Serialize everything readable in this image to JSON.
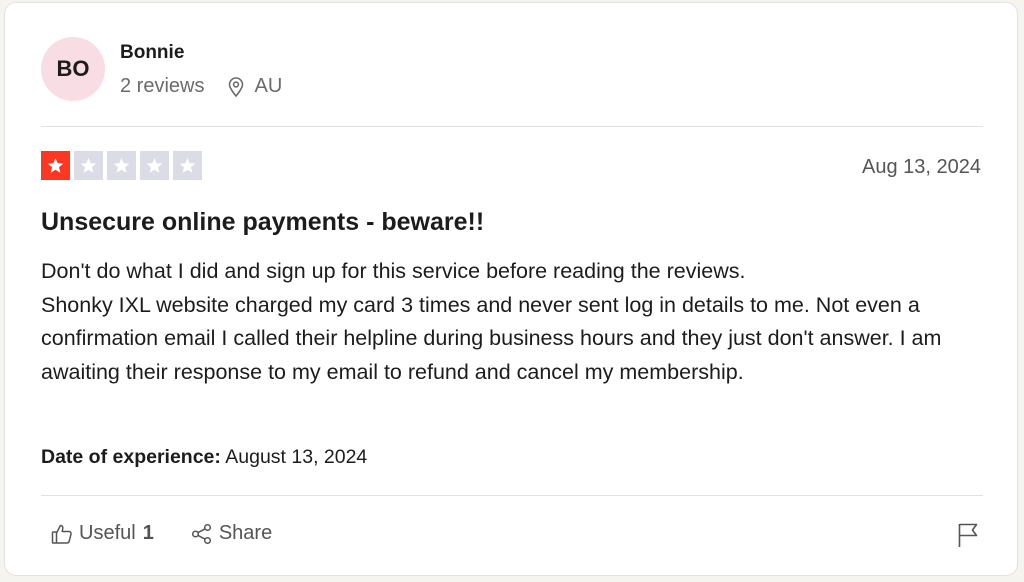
{
  "reviewer": {
    "initials": "BO",
    "avatar_color": "#f9dde4",
    "name": "Bonnie",
    "reviews_count": "2 reviews",
    "location_icon": "map-pin-icon",
    "location": "AU"
  },
  "review": {
    "rating": 1,
    "max_rating": 5,
    "rating_color": "#ff3722",
    "empty_star_color": "#dcdce6",
    "date": "Aug 13, 2024",
    "title": "Unsecure online payments - beware!!",
    "body": "Don't do what I did and sign up for this service before reading the reviews.\nShonky IXL website charged my card 3 times and never sent log in details to me. Not even a confirmation email I called their helpline during business hours and they just don't answer. I am awaiting their response to my email to refund and cancel my membership.",
    "experience_label": "Date of experience:",
    "experience_date": "August 13, 2024"
  },
  "actions": {
    "useful_icon": "thumbs-up-icon",
    "useful_label": "Useful",
    "useful_count": "1",
    "share_icon": "share-icon",
    "share_label": "Share",
    "flag_icon": "flag-icon"
  }
}
